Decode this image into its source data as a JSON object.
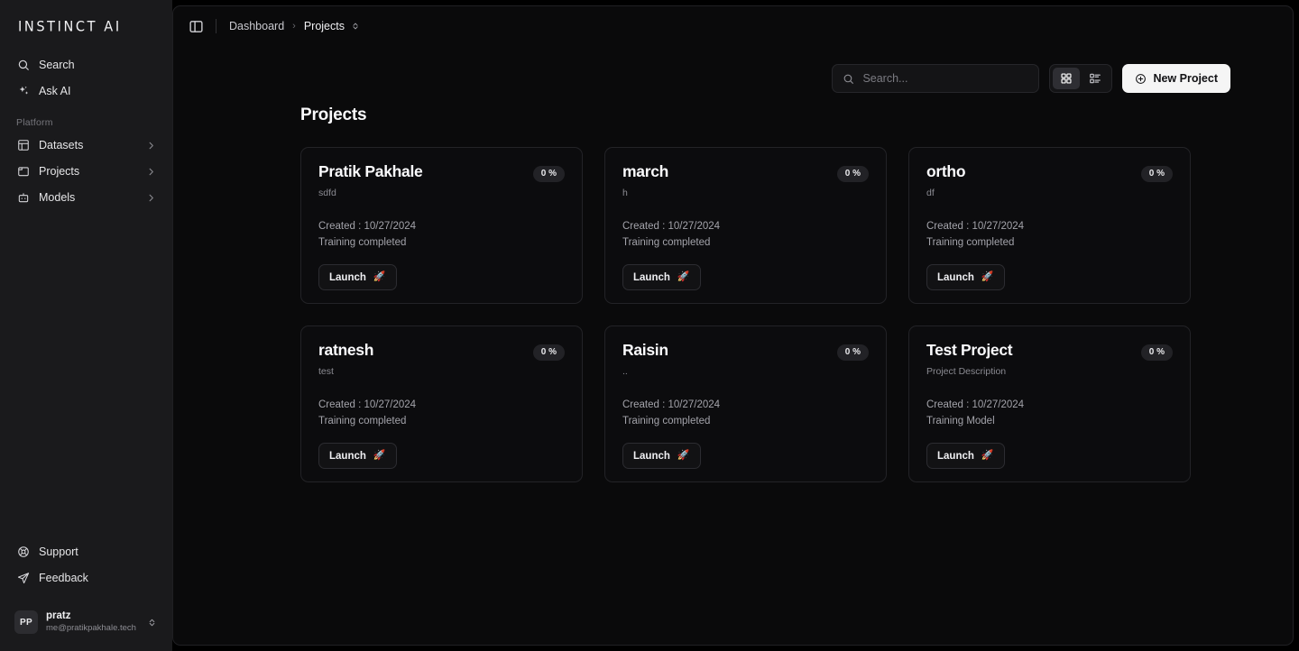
{
  "brand": {
    "logo_text": "INSTINCT AI"
  },
  "sidebar": {
    "quick_items": [
      {
        "label": "Search",
        "icon": "search-icon"
      },
      {
        "label": "Ask AI",
        "icon": "sparkles-icon"
      }
    ],
    "section_label": "Platform",
    "platform_items": [
      {
        "label": "Datasets",
        "icon": "table-icon",
        "chevron": "›"
      },
      {
        "label": "Projects",
        "icon": "folder-icon",
        "chevron": "›"
      },
      {
        "label": "Models",
        "icon": "bot-icon",
        "chevron": "›"
      }
    ],
    "bottom_items": [
      {
        "label": "Support",
        "icon": "lifebuoy-icon"
      },
      {
        "label": "Feedback",
        "icon": "send-icon"
      }
    ],
    "user": {
      "initials": "PP",
      "name": "pratz",
      "email": "me@pratikpakhale.tech",
      "chevron": "⌃⌄"
    }
  },
  "topbar": {
    "panel_toggle_icon": "sidebar-toggle-icon",
    "breadcrumb": {
      "root": "Dashboard",
      "separator": "›",
      "current": "Projects",
      "current_chevron": "⇵"
    }
  },
  "toolbar": {
    "search_placeholder": "Search...",
    "search_value": "",
    "view_grid_label": "grid-view",
    "view_list_label": "list-view",
    "active_view": "grid",
    "new_project_label": "New Project"
  },
  "main": {
    "page_title": "Projects",
    "created_prefix": "Created : ",
    "launch_label": "Launch",
    "rocket_glyph": "🚀",
    "projects": [
      {
        "name": "Pratik Pakhale",
        "description": "sdfd",
        "progress": "0 %",
        "created": "Created : 10/27/2024",
        "status": "Training completed",
        "launch": "Launch"
      },
      {
        "name": "march",
        "description": "h",
        "progress": "0 %",
        "created": "Created : 10/27/2024",
        "status": "Training completed",
        "launch": "Launch"
      },
      {
        "name": "ortho",
        "description": "df",
        "progress": "0 %",
        "created": "Created : 10/27/2024",
        "status": "Training completed",
        "launch": "Launch"
      },
      {
        "name": "ratnesh",
        "description": "test",
        "progress": "0 %",
        "created": "Created : 10/27/2024",
        "status": "Training completed",
        "launch": "Launch"
      },
      {
        "name": "Raisin",
        "description": "..",
        "progress": "0 %",
        "created": "Created : 10/27/2024",
        "status": "Training completed",
        "launch": "Launch"
      },
      {
        "name": "Test Project",
        "description": "Project Description",
        "progress": "0 %",
        "created": "Created : 10/27/2024",
        "status": "Training Model",
        "launch": "Launch"
      }
    ]
  },
  "colors": {
    "app_bg": "#000000",
    "sidebar_bg": "#1a1a1c",
    "panel_bg": "#0a0a0b",
    "card_bg": "#0c0c0e",
    "card_border": "#232327",
    "accent_button": "#f5f5f5",
    "text_primary": "#fafafc",
    "text_muted": "#8b8b92"
  }
}
